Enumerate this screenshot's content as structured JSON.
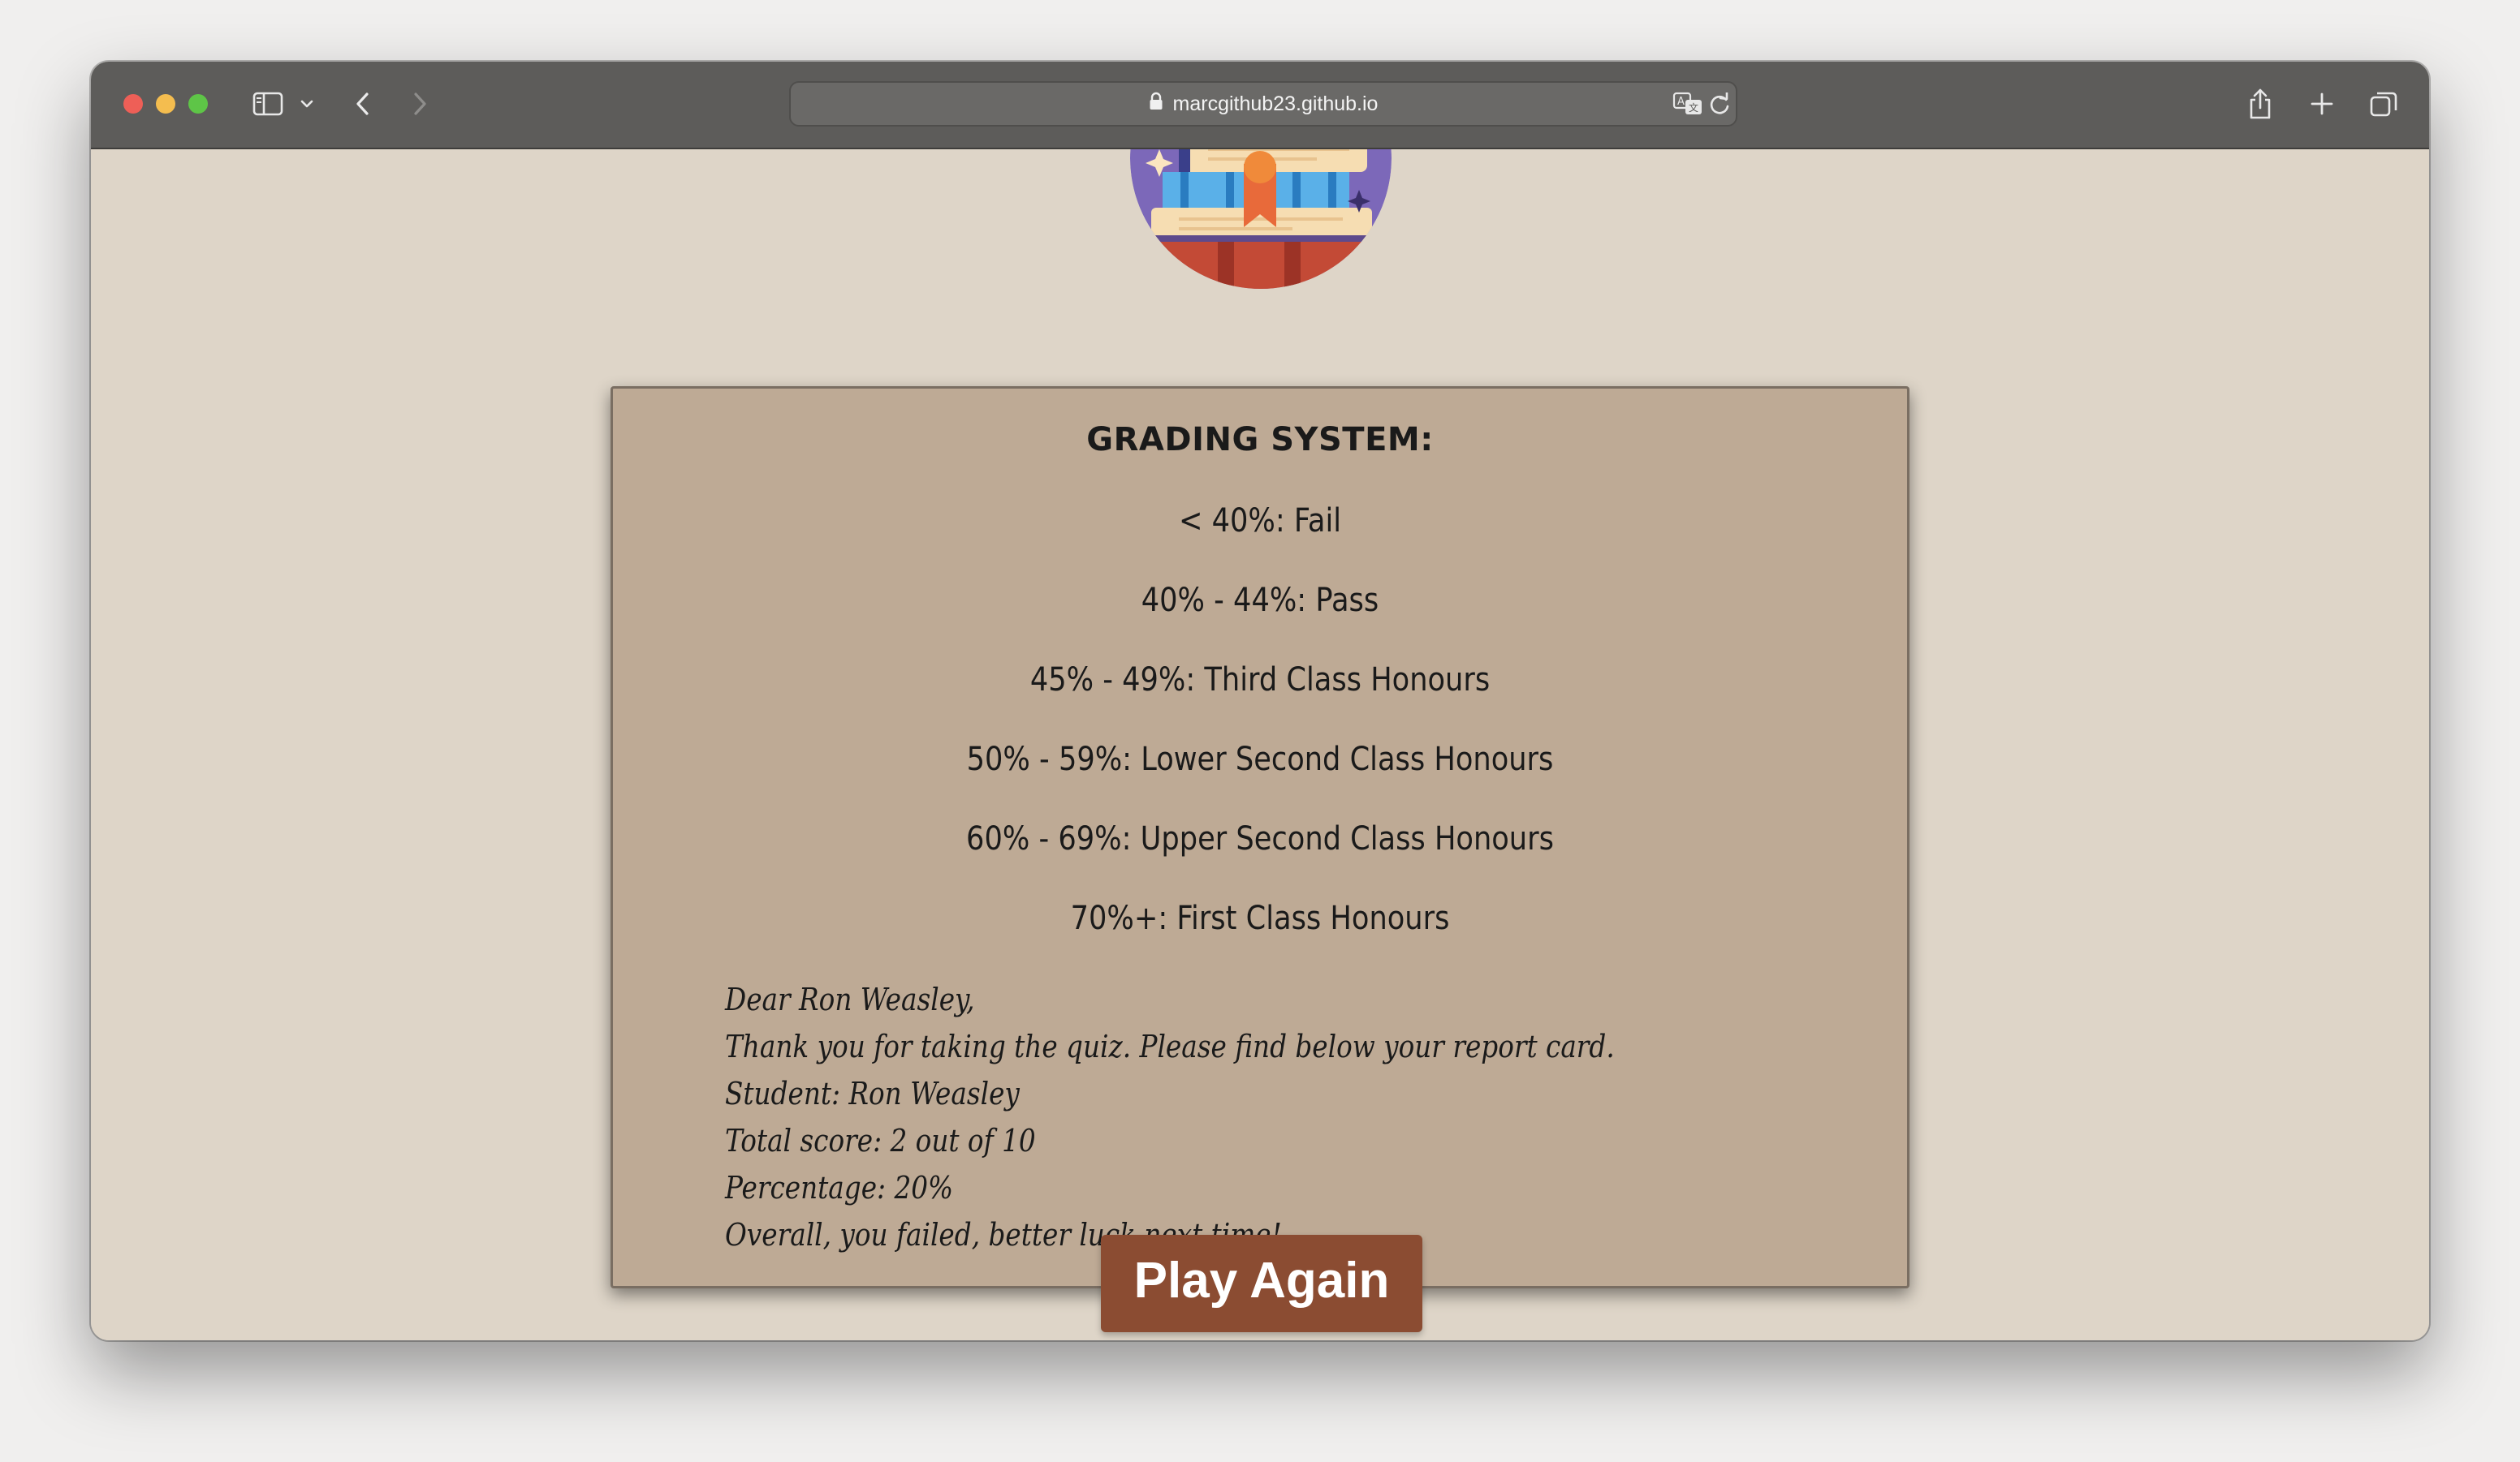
{
  "browser": {
    "url": "marcgithub23.github.io"
  },
  "grading": {
    "title": "GRADING SYSTEM:",
    "bands": [
      "< 40%: Fail",
      "40% - 44%: Pass",
      "45% - 49%: Third Class Honours",
      "50% - 59%: Lower Second Class Honours",
      "60% - 69%: Upper Second Class Honours",
      "70%+: First Class Honours"
    ]
  },
  "report": {
    "greeting": "Dear Ron Weasley,",
    "intro": "Thank you for taking the quiz. Please find below your report card.",
    "student": "Student: Ron Weasley",
    "score": "Total score: 2 out of 10",
    "percentage": "Percentage: 20%",
    "verdict": "Overall, you failed, better luck next time!"
  },
  "actions": {
    "play_again_label": "Play Again"
  },
  "colors": {
    "page_background": "#ded5c8",
    "card_background": "#beaa95",
    "button_background": "#8b4c32",
    "titlebar": "#5d5c5a"
  },
  "icons": {
    "logo": "books-stack-logo",
    "lock": "lock-icon",
    "translate": "translate-icon",
    "reload": "reload-icon"
  }
}
